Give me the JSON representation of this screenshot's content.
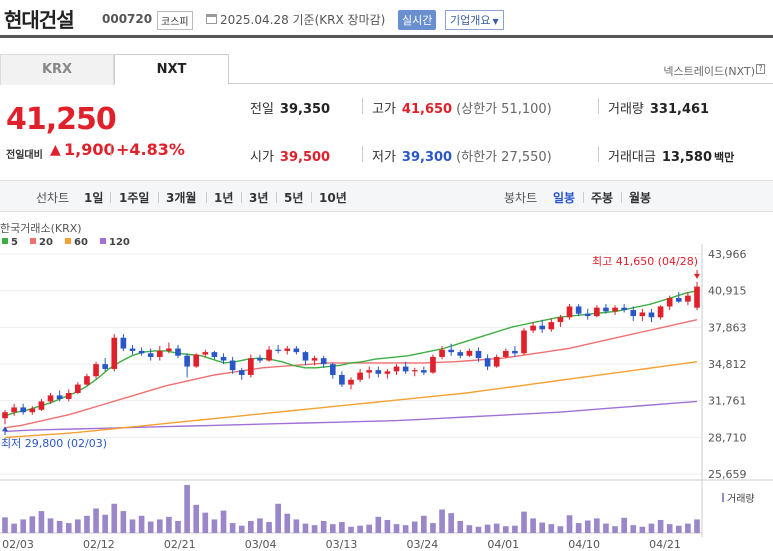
{
  "header": {
    "company": "현대건설",
    "code": "000720",
    "market": "코스피",
    "date_text": "2025.04.28 기준(KRX 장마감)",
    "realtime_label": "실시간",
    "company_info_label": "기업개요"
  },
  "tabs": [
    {
      "label": "KRX",
      "active": false
    },
    {
      "label": "NXT",
      "active": true
    }
  ],
  "nxt_link": "넥스트레이드(NXT)",
  "price": {
    "current": "41,250",
    "change_label": "전일대비",
    "change_value": "1,900",
    "change_rate": "+4.83%",
    "direction": "up"
  },
  "metrics": {
    "prev_close": {
      "label": "전일",
      "value": "39,350"
    },
    "open": {
      "label": "시가",
      "value": "39,500"
    },
    "high": {
      "label": "고가",
      "value": "41,650",
      "limit_label": "(상한가 51,100)"
    },
    "low": {
      "label": "저가",
      "value": "39,300",
      "limit_label": "(하한가 27,550)"
    },
    "volume": {
      "label": "거래량",
      "value": "331,461"
    },
    "trade_amount": {
      "label": "거래대금",
      "value": "13,580",
      "unit": "백만"
    }
  },
  "chart_toolbar": {
    "line_title": "선차트",
    "periods": [
      "1일",
      "1주일",
      "3개월",
      "1년",
      "3년",
      "5년",
      "10년"
    ],
    "candle_title": "봉차트",
    "candle_periods": [
      "일봉",
      "주봉",
      "월봉"
    ],
    "active_candle": "일봉"
  },
  "colors": {
    "up": "#e0202a",
    "down": "#2a57c8",
    "ma5": "#3cb043",
    "ma20": "#f07070",
    "ma60": "#f5a030",
    "ma120": "#a070d8",
    "volume": "#9a86c8"
  },
  "chart_data": {
    "type": "candlestick",
    "source_label": "한국거래소(KRX)",
    "legend": [
      "5",
      "20",
      "60",
      "120"
    ],
    "y_ticks": [
      43966,
      40915,
      37863,
      34812,
      31761,
      28710,
      25659
    ],
    "ylim": [
      25659,
      43966
    ],
    "x_labels": [
      "02/03",
      "02/12",
      "02/21",
      "03/04",
      "03/13",
      "03/24",
      "04/01",
      "04/10",
      "04/21"
    ],
    "high_annotation": "최고 41,650 (04/28)",
    "low_annotation": "최저 29,800 (02/03)",
    "volume_label": "거래량",
    "candles": [
      {
        "o": 30300,
        "h": 31000,
        "l": 29800,
        "c": 30800
      },
      {
        "o": 30800,
        "h": 31500,
        "l": 30500,
        "c": 31200
      },
      {
        "o": 31200,
        "h": 31500,
        "l": 30600,
        "c": 30800
      },
      {
        "o": 30800,
        "h": 31300,
        "l": 30600,
        "c": 31100
      },
      {
        "o": 31000,
        "h": 31900,
        "l": 30900,
        "c": 31700
      },
      {
        "o": 31700,
        "h": 32400,
        "l": 31500,
        "c": 32200
      },
      {
        "o": 32200,
        "h": 32600,
        "l": 31700,
        "c": 31900
      },
      {
        "o": 31900,
        "h": 32700,
        "l": 31700,
        "c": 32400
      },
      {
        "o": 32400,
        "h": 33300,
        "l": 32300,
        "c": 33100
      },
      {
        "o": 33100,
        "h": 34000,
        "l": 33000,
        "c": 33800
      },
      {
        "o": 33800,
        "h": 35000,
        "l": 33600,
        "c": 34800
      },
      {
        "o": 34800,
        "h": 35300,
        "l": 34200,
        "c": 34400
      },
      {
        "o": 34400,
        "h": 37300,
        "l": 34200,
        "c": 37000
      },
      {
        "o": 37000,
        "h": 37300,
        "l": 35900,
        "c": 36100
      },
      {
        "o": 36100,
        "h": 36400,
        "l": 35600,
        "c": 35900
      },
      {
        "o": 35900,
        "h": 36200,
        "l": 35500,
        "c": 35700
      },
      {
        "o": 35700,
        "h": 36100,
        "l": 35100,
        "c": 35400
      },
      {
        "o": 35400,
        "h": 36300,
        "l": 35100,
        "c": 35900
      },
      {
        "o": 35900,
        "h": 36600,
        "l": 35700,
        "c": 36100
      },
      {
        "o": 36100,
        "h": 36400,
        "l": 35300,
        "c": 35500
      },
      {
        "o": 35500,
        "h": 35700,
        "l": 33700,
        "c": 34600
      },
      {
        "o": 34600,
        "h": 35700,
        "l": 34500,
        "c": 35600
      },
      {
        "o": 35600,
        "h": 36000,
        "l": 35400,
        "c": 35800
      },
      {
        "o": 35800,
        "h": 35900,
        "l": 35200,
        "c": 35400
      },
      {
        "o": 35400,
        "h": 35700,
        "l": 34800,
        "c": 35100
      },
      {
        "o": 35100,
        "h": 35400,
        "l": 34000,
        "c": 34300
      },
      {
        "o": 34300,
        "h": 34500,
        "l": 33500,
        "c": 33900
      },
      {
        "o": 33900,
        "h": 35600,
        "l": 33700,
        "c": 35300
      },
      {
        "o": 35300,
        "h": 35600,
        "l": 34900,
        "c": 35100
      },
      {
        "o": 35100,
        "h": 36300,
        "l": 35000,
        "c": 36000
      },
      {
        "o": 36000,
        "h": 36400,
        "l": 35700,
        "c": 35900
      },
      {
        "o": 35900,
        "h": 36300,
        "l": 35600,
        "c": 36100
      },
      {
        "o": 36100,
        "h": 36300,
        "l": 35600,
        "c": 35800
      },
      {
        "o": 35800,
        "h": 35900,
        "l": 34700,
        "c": 35100
      },
      {
        "o": 35100,
        "h": 35500,
        "l": 34700,
        "c": 35300
      },
      {
        "o": 35300,
        "h": 35500,
        "l": 34500,
        "c": 34800
      },
      {
        "o": 34800,
        "h": 34900,
        "l": 33600,
        "c": 33900
      },
      {
        "o": 33900,
        "h": 34200,
        "l": 32900,
        "c": 33100
      },
      {
        "o": 33100,
        "h": 33700,
        "l": 32700,
        "c": 33500
      },
      {
        "o": 33500,
        "h": 34400,
        "l": 33300,
        "c": 34100
      },
      {
        "o": 34100,
        "h": 34600,
        "l": 33600,
        "c": 34300
      },
      {
        "o": 34300,
        "h": 34600,
        "l": 33700,
        "c": 34000
      },
      {
        "o": 34000,
        "h": 34400,
        "l": 33600,
        "c": 34200
      },
      {
        "o": 34200,
        "h": 34800,
        "l": 33900,
        "c": 34600
      },
      {
        "o": 34600,
        "h": 35000,
        "l": 34000,
        "c": 34200
      },
      {
        "o": 34200,
        "h": 34500,
        "l": 33800,
        "c": 34300
      },
      {
        "o": 34300,
        "h": 34600,
        "l": 33900,
        "c": 34100
      },
      {
        "o": 34100,
        "h": 35600,
        "l": 34000,
        "c": 35400
      },
      {
        "o": 35400,
        "h": 36300,
        "l": 35200,
        "c": 36000
      },
      {
        "o": 36000,
        "h": 36500,
        "l": 35500,
        "c": 35800
      },
      {
        "o": 35800,
        "h": 36000,
        "l": 35300,
        "c": 35500
      },
      {
        "o": 35500,
        "h": 36100,
        "l": 35400,
        "c": 35900
      },
      {
        "o": 35900,
        "h": 36200,
        "l": 35000,
        "c": 35300
      },
      {
        "o": 35300,
        "h": 35600,
        "l": 34300,
        "c": 34600
      },
      {
        "o": 34600,
        "h": 35600,
        "l": 34500,
        "c": 35400
      },
      {
        "o": 35400,
        "h": 36100,
        "l": 35300,
        "c": 35900
      },
      {
        "o": 35900,
        "h": 36300,
        "l": 35400,
        "c": 35700
      },
      {
        "o": 35700,
        "h": 37800,
        "l": 35600,
        "c": 37600
      },
      {
        "o": 37600,
        "h": 38300,
        "l": 37400,
        "c": 38000
      },
      {
        "o": 38000,
        "h": 38500,
        "l": 37400,
        "c": 37700
      },
      {
        "o": 37700,
        "h": 38600,
        "l": 37500,
        "c": 38300
      },
      {
        "o": 38300,
        "h": 38900,
        "l": 37900,
        "c": 38700
      },
      {
        "o": 38700,
        "h": 39800,
        "l": 38500,
        "c": 39600
      },
      {
        "o": 39600,
        "h": 39800,
        "l": 38800,
        "c": 39000
      },
      {
        "o": 39000,
        "h": 39400,
        "l": 38500,
        "c": 38800
      },
      {
        "o": 38800,
        "h": 39700,
        "l": 38700,
        "c": 39500
      },
      {
        "o": 39500,
        "h": 39800,
        "l": 39000,
        "c": 39200
      },
      {
        "o": 39200,
        "h": 39700,
        "l": 38900,
        "c": 39500
      },
      {
        "o": 39500,
        "h": 39800,
        "l": 39100,
        "c": 39300
      },
      {
        "o": 39300,
        "h": 39600,
        "l": 38400,
        "c": 38800
      },
      {
        "o": 38800,
        "h": 39400,
        "l": 38400,
        "c": 39100
      },
      {
        "o": 39100,
        "h": 39400,
        "l": 38300,
        "c": 38700
      },
      {
        "o": 38700,
        "h": 39700,
        "l": 38500,
        "c": 39600
      },
      {
        "o": 39600,
        "h": 40500,
        "l": 39300,
        "c": 40300
      },
      {
        "o": 40300,
        "h": 40800,
        "l": 39900,
        "c": 40000
      },
      {
        "o": 40000,
        "h": 40800,
        "l": 39700,
        "c": 40500
      },
      {
        "o": 39500,
        "h": 41650,
        "l": 39300,
        "c": 41250
      }
    ],
    "ma5": [
      30500,
      30800,
      31000,
      31300,
      31600,
      32000,
      32400,
      32900,
      33600,
      34400,
      35000,
      35500,
      35800,
      35900,
      35900,
      35700,
      35600,
      35500,
      35200,
      34900,
      35000,
      35200,
      35300,
      35200,
      35000,
      34700,
      34500,
      34500,
      34600,
      34700,
      34900,
      35000,
      35200,
      35300,
      35400,
      35500,
      35700,
      35900,
      36100,
      36400,
      36700,
      37000,
      37300,
      37600,
      37900,
      38100,
      38300,
      38500,
      38700,
      38800,
      38900,
      39000,
      39100,
      39200,
      39400,
      39600,
      39800,
      40100,
      40400,
      40700,
      40900
    ],
    "ma20": [
      29500,
      29700,
      30000,
      30300,
      30600,
      31000,
      31400,
      31800,
      32200,
      32600,
      33000,
      33300,
      33600,
      33900,
      34100,
      34300,
      34500,
      34600,
      34700,
      34800,
      34900,
      34900,
      34900,
      34900,
      34900,
      34900,
      34900,
      34950,
      35000,
      35100,
      35200,
      35300,
      35500,
      35700,
      35900,
      36100,
      36400,
      36700,
      37000,
      37300,
      37600,
      37900,
      38200,
      38500
    ],
    "ma60": [
      28700,
      28800,
      28900,
      29000,
      29100,
      29250,
      29400,
      29550,
      29700,
      29850,
      30000,
      30150,
      30300,
      30450,
      30600,
      30750,
      30900,
      31050,
      31200,
      31350,
      31500,
      31650,
      31800,
      31950,
      32100,
      32250,
      32400,
      32600,
      32800,
      33000,
      33200,
      33400,
      33600,
      33800,
      34000,
      34200,
      34400,
      34600,
      34800,
      35000
    ],
    "ma120": [
      29200,
      29300,
      29350,
      29400,
      29450,
      29500,
      29550,
      29600,
      29650,
      29700,
      29750,
      29800,
      29850,
      29900,
      29950,
      30000,
      30050,
      30100,
      30200,
      30300,
      30400,
      30500,
      30600,
      30700,
      30800,
      30950,
      31100,
      31250,
      31400,
      31550,
      31700
    ],
    "volumes": [
      300,
      180,
      260,
      320,
      420,
      280,
      230,
      190,
      260,
      330,
      470,
      350,
      560,
      420,
      260,
      330,
      220,
      260,
      310,
      230,
      920,
      540,
      390,
      260,
      430,
      190,
      140,
      230,
      280,
      210,
      560,
      370,
      260,
      180,
      150,
      230,
      170,
      210,
      120,
      140,
      160,
      310,
      250,
      170,
      150,
      220,
      330,
      190,
      450,
      380,
      230,
      150,
      120,
      160,
      180,
      130,
      140,
      410,
      280,
      200,
      170,
      130,
      340,
      190,
      240,
      280,
      180,
      130,
      290,
      150,
      120,
      180,
      250,
      170,
      140,
      180,
      260
    ]
  }
}
